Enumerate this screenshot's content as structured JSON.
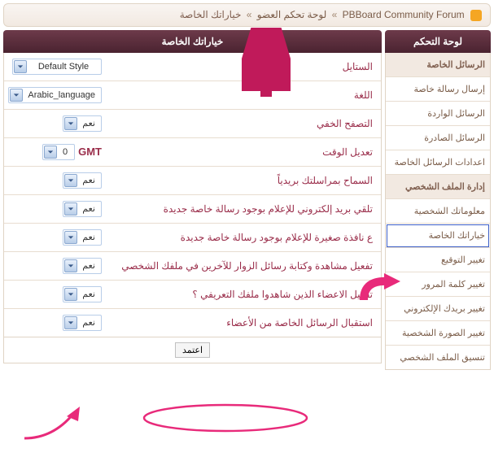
{
  "breadcrumb": {
    "forum": "PBBoard Community Forum",
    "sep": "»",
    "cp": "لوحة تحكم العضو",
    "page": "خياراتك الخاصة"
  },
  "sidebar": {
    "title": "لوحة التحكم",
    "items": [
      {
        "label": "الرسائل الخاصة",
        "section": true
      },
      {
        "label": "إرسال رسالة خاصة"
      },
      {
        "label": "الرسائل الواردة"
      },
      {
        "label": "الرسائل الصادرة"
      },
      {
        "label": "اعدادات الرسائل الخاصة"
      },
      {
        "label": "إدارة الملف الشخصي",
        "section": true
      },
      {
        "label": "معلوماتك الشخصية"
      },
      {
        "label": "خياراتك الخاصة",
        "selected": true
      },
      {
        "label": "تغيير التوقيع"
      },
      {
        "label": "تغيير كلمة المرور"
      },
      {
        "label": "تغيير بريدك الإلكتروني"
      },
      {
        "label": "تغيير الصورة الشخصية"
      },
      {
        "label": "تنسيق الملف الشخصي"
      }
    ]
  },
  "main": {
    "title": "خياراتك الخاصة",
    "rows": [
      {
        "label": "الستايل",
        "value": "Default Style",
        "wide": true
      },
      {
        "label": "اللغة",
        "value": "Arabic_language",
        "wide": true
      },
      {
        "label": "التصفح الخفي",
        "value": "نعم"
      },
      {
        "label": "تعديل الوقت",
        "value": "0",
        "gmt": "GMT"
      },
      {
        "label": "السماح بمراسلتك بريدياً",
        "value": "نعم"
      },
      {
        "label": "تلقي بريد إلكتروني للإعلام بوجود رسالة خاصة جديدة",
        "value": "نعم"
      },
      {
        "label": "ع نافذة صغيرة للإعلام بوجود رسالة خاصة جديدة",
        "value": "نعم"
      },
      {
        "label": "تفعيل مشاهدة وكتابة رسائل الزوار للآخرين في ملفك الشخصي",
        "value": "نعم"
      },
      {
        "label": "تفعيل الاعضاء الذين شاهدوا ملفك التعريفي ؟",
        "value": "نعم"
      },
      {
        "label": "استقبال الرسائل الخاصة من الأعضاء",
        "value": "نعم"
      }
    ],
    "submit": "اعتمد"
  }
}
